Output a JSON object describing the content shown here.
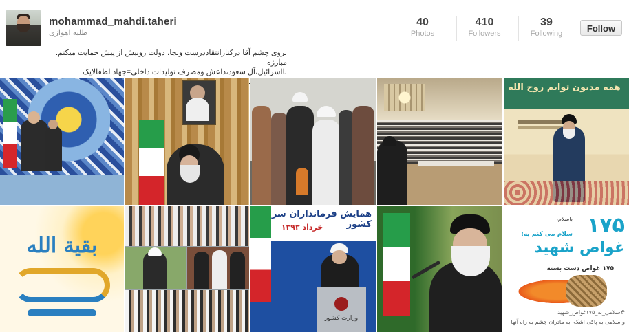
{
  "profile": {
    "username": "mohammad_mahdi.taheri",
    "subtitle": "طلبه اهوازی",
    "bio_line1": "بروی چشم آقا درکنارانتقاددرست وبجا، دولت روبیش از پیش حمایت میکنم. مبارزه",
    "bio_line2": "بااسرائیل،آل سعود،داعش ومصرف تولیدات داخلی=جهاد لطفالایک کنندہ\"منن ها\"باشید"
  },
  "stats": {
    "photos_count": "40",
    "photos_label": "Photos",
    "followers_count": "410",
    "followers_label": "Followers",
    "following_count": "39",
    "following_label": "Following"
  },
  "follow_button": "Follow",
  "photos": {
    "p4_caption": "",
    "p5_title": "همه مدیون توایم روح الله",
    "p8_title": "همایش فرمانداران سراسر کشور",
    "p8_date": "خرداد ۱۳۹۳",
    "p8_podium": "وزارت کشور",
    "p10_number": "۱۷۵",
    "p10_title": "غواص شهید",
    "p10_line1": "باسلام،",
    "p10_line2": "سلام می کنم به:",
    "p10_line3": "۱۷۵ غواص دست بسته",
    "p10_footer": "#سلامی_به_۱۷۵غواص_شهید",
    "p10_footer2": "و سلامی به پاکی اشک، به مادران چشم به راه آنها",
    "p6_calligraphy": "بقیة الله"
  }
}
